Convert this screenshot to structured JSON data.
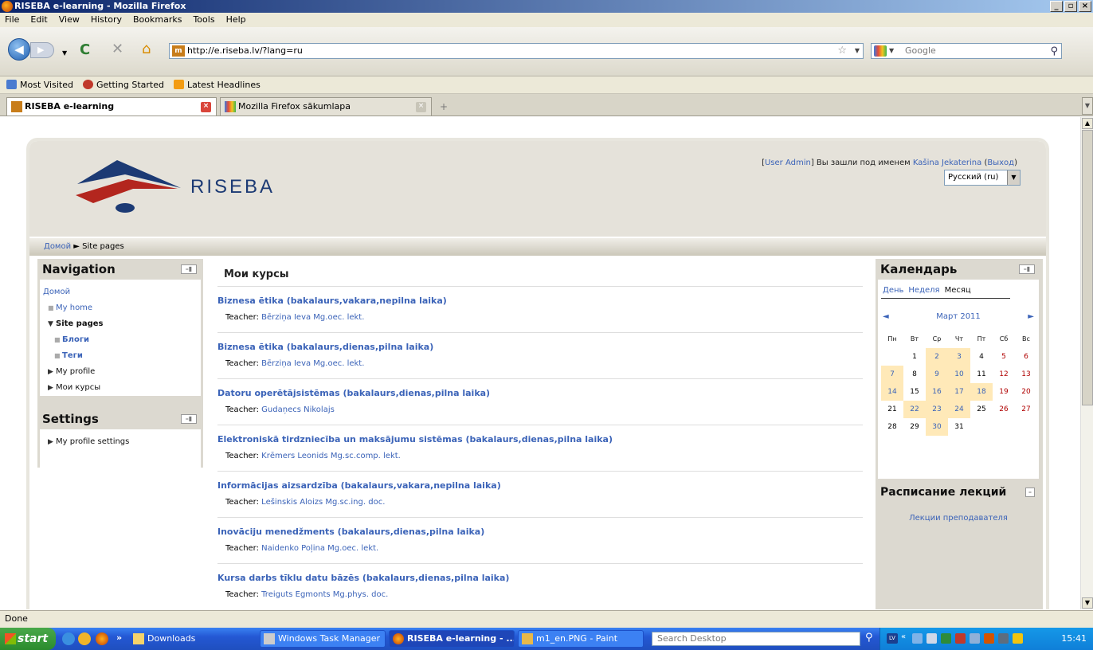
{
  "window": {
    "title": "RISEBA e-learning - Mozilla Firefox"
  },
  "menu": [
    "File",
    "Edit",
    "View",
    "History",
    "Bookmarks",
    "Tools",
    "Help"
  ],
  "address": {
    "url": "http://e.riseba.lv/?lang=ru",
    "search_placeholder": "Google"
  },
  "bookmarks": [
    "Most Visited",
    "Getting Started",
    "Latest Headlines"
  ],
  "tabs": [
    {
      "label": "RISEBA e-learning",
      "active": true
    },
    {
      "label": "Mozilla Firefox sākumlapa",
      "active": false
    }
  ],
  "site": {
    "logo_text": "RISEBA",
    "login": {
      "prefix": "[",
      "admin": "User Admin",
      "mid": "] Вы зашли под именем ",
      "user": "Kašina Jekaterina",
      "logout_open": " (",
      "logout": "Выход",
      "logout_close": ")"
    },
    "lang": "Русский (ru)",
    "breadcrumb": {
      "home": "Домой",
      "sep": " ► ",
      "current": "Site pages"
    }
  },
  "navigation": {
    "title": "Navigation",
    "home": "Домой",
    "my_home": "My home",
    "site_pages": "Site pages",
    "blogs": "Блоги",
    "tags": "Теги",
    "my_profile": "My profile",
    "my_courses": "Мои курсы"
  },
  "settings": {
    "title": "Settings",
    "profile_settings": "My profile settings"
  },
  "main": {
    "heading": "Мои курсы",
    "teacher_label": "Teacher: ",
    "courses": [
      {
        "title": "Biznesa ētika (bakalaurs,vakara,nepilna laika)",
        "teacher": "Bērziņa Ieva Mg.oec. lekt."
      },
      {
        "title": "Biznesa ētika (bakalaurs,dienas,pilna laika)",
        "teacher": "Bērziņa Ieva Mg.oec. lekt."
      },
      {
        "title": "Datoru operētājsistēmas (bakalaurs,dienas,pilna laika)",
        "teacher": "Gudaņecs Nikolajs"
      },
      {
        "title": "Elektroniskā tirdzniecība un maksājumu sistēmas (bakalaurs,dienas,pilna laika)",
        "teacher": "Krēmers Leonids Mg.sc.comp. lekt."
      },
      {
        "title": "Informācijas aizsardzība (bakalaurs,vakara,nepilna laika)",
        "teacher": "Lešinskis Aloizs Mg.sc.ing. doc."
      },
      {
        "title": "Inovāciju menedžments (bakalaurs,dienas,pilna laika)",
        "teacher": "Naidenko Poļina Mg.oec. lekt."
      },
      {
        "title": "Kursa darbs tīklu datu bāzēs (bakalaurs,dienas,pilna laika)",
        "teacher": "Treiguts Egmonts Mg.phys. doc."
      }
    ]
  },
  "calendar": {
    "title": "Календарь",
    "modes": [
      "День",
      "Неделя",
      "Месяц"
    ],
    "month": "Март 2011",
    "weekdays": [
      "Пн",
      "Вт",
      "Ср",
      "Чт",
      "Пт",
      "Сб",
      "Вс"
    ],
    "days": [
      "",
      "1",
      "2",
      "3",
      "4",
      "5",
      "6",
      "7",
      "8",
      "9",
      "10",
      "11",
      "12",
      "13",
      "14",
      "15",
      "16",
      "17",
      "18",
      "19",
      "20",
      "21",
      "22",
      "23",
      "24",
      "25",
      "26",
      "27",
      "28",
      "29",
      "30",
      "31",
      "",
      "",
      ""
    ],
    "event_days": [
      "2",
      "3",
      "7",
      "9",
      "10",
      "14",
      "16",
      "17",
      "18",
      "22",
      "23",
      "24",
      "30"
    ],
    "weekend_days": [
      "5",
      "6",
      "12",
      "13",
      "19",
      "20",
      "26",
      "27"
    ]
  },
  "lectures": {
    "title": "Расписание лекций",
    "link": "Лекции преподавателя"
  },
  "status": "Done",
  "taskbar": {
    "start": "start",
    "buttons": [
      "Downloads",
      "Windows Task Manager",
      "RISEBA e-learning - ...",
      "m1_en.PNG - Paint"
    ],
    "search_placeholder": "Search Desktop",
    "clock": "15:41",
    "lang": "LV"
  }
}
